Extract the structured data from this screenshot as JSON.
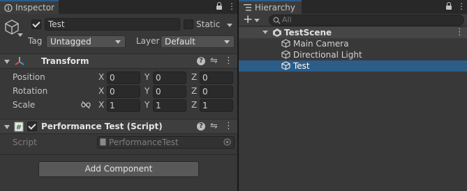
{
  "inspector": {
    "tab_label": "Inspector",
    "menu_icon": "kebab-menu-icon",
    "object": {
      "name": "Test",
      "active": true,
      "static_label": "Static",
      "static": false,
      "tag_label": "Tag",
      "tag_value": "Untagged",
      "layer_label": "Layer",
      "layer_value": "Default"
    },
    "transform": {
      "title": "Transform",
      "rows": [
        {
          "label": "Position",
          "x": "0",
          "y": "0",
          "z": "0"
        },
        {
          "label": "Rotation",
          "x": "0",
          "y": "0",
          "z": "0"
        },
        {
          "label": "Scale",
          "x": "1",
          "y": "1",
          "z": "1"
        }
      ],
      "axis_x": "X",
      "axis_y": "Y",
      "axis_z": "Z",
      "constrain_icon": "link-broken-icon"
    },
    "script_component": {
      "title": "Performance Test (Script)",
      "enabled": true,
      "script_label": "Script",
      "script_value": "PerformanceTest"
    },
    "add_component_label": "Add Component"
  },
  "hierarchy": {
    "tab_label": "Hierarchy",
    "add_label": "+",
    "search_placeholder": "All",
    "scene": "TestScene",
    "items": [
      "Main Camera",
      "Directional Light",
      "Test"
    ],
    "selected_index": 2
  },
  "colors": {
    "panel_bg": "#383838",
    "selection": "#2c5d87",
    "transform_icon_red": "#e14b4b",
    "transform_icon_green": "#7fc14f",
    "transform_icon_blue": "#4b8fe1"
  }
}
